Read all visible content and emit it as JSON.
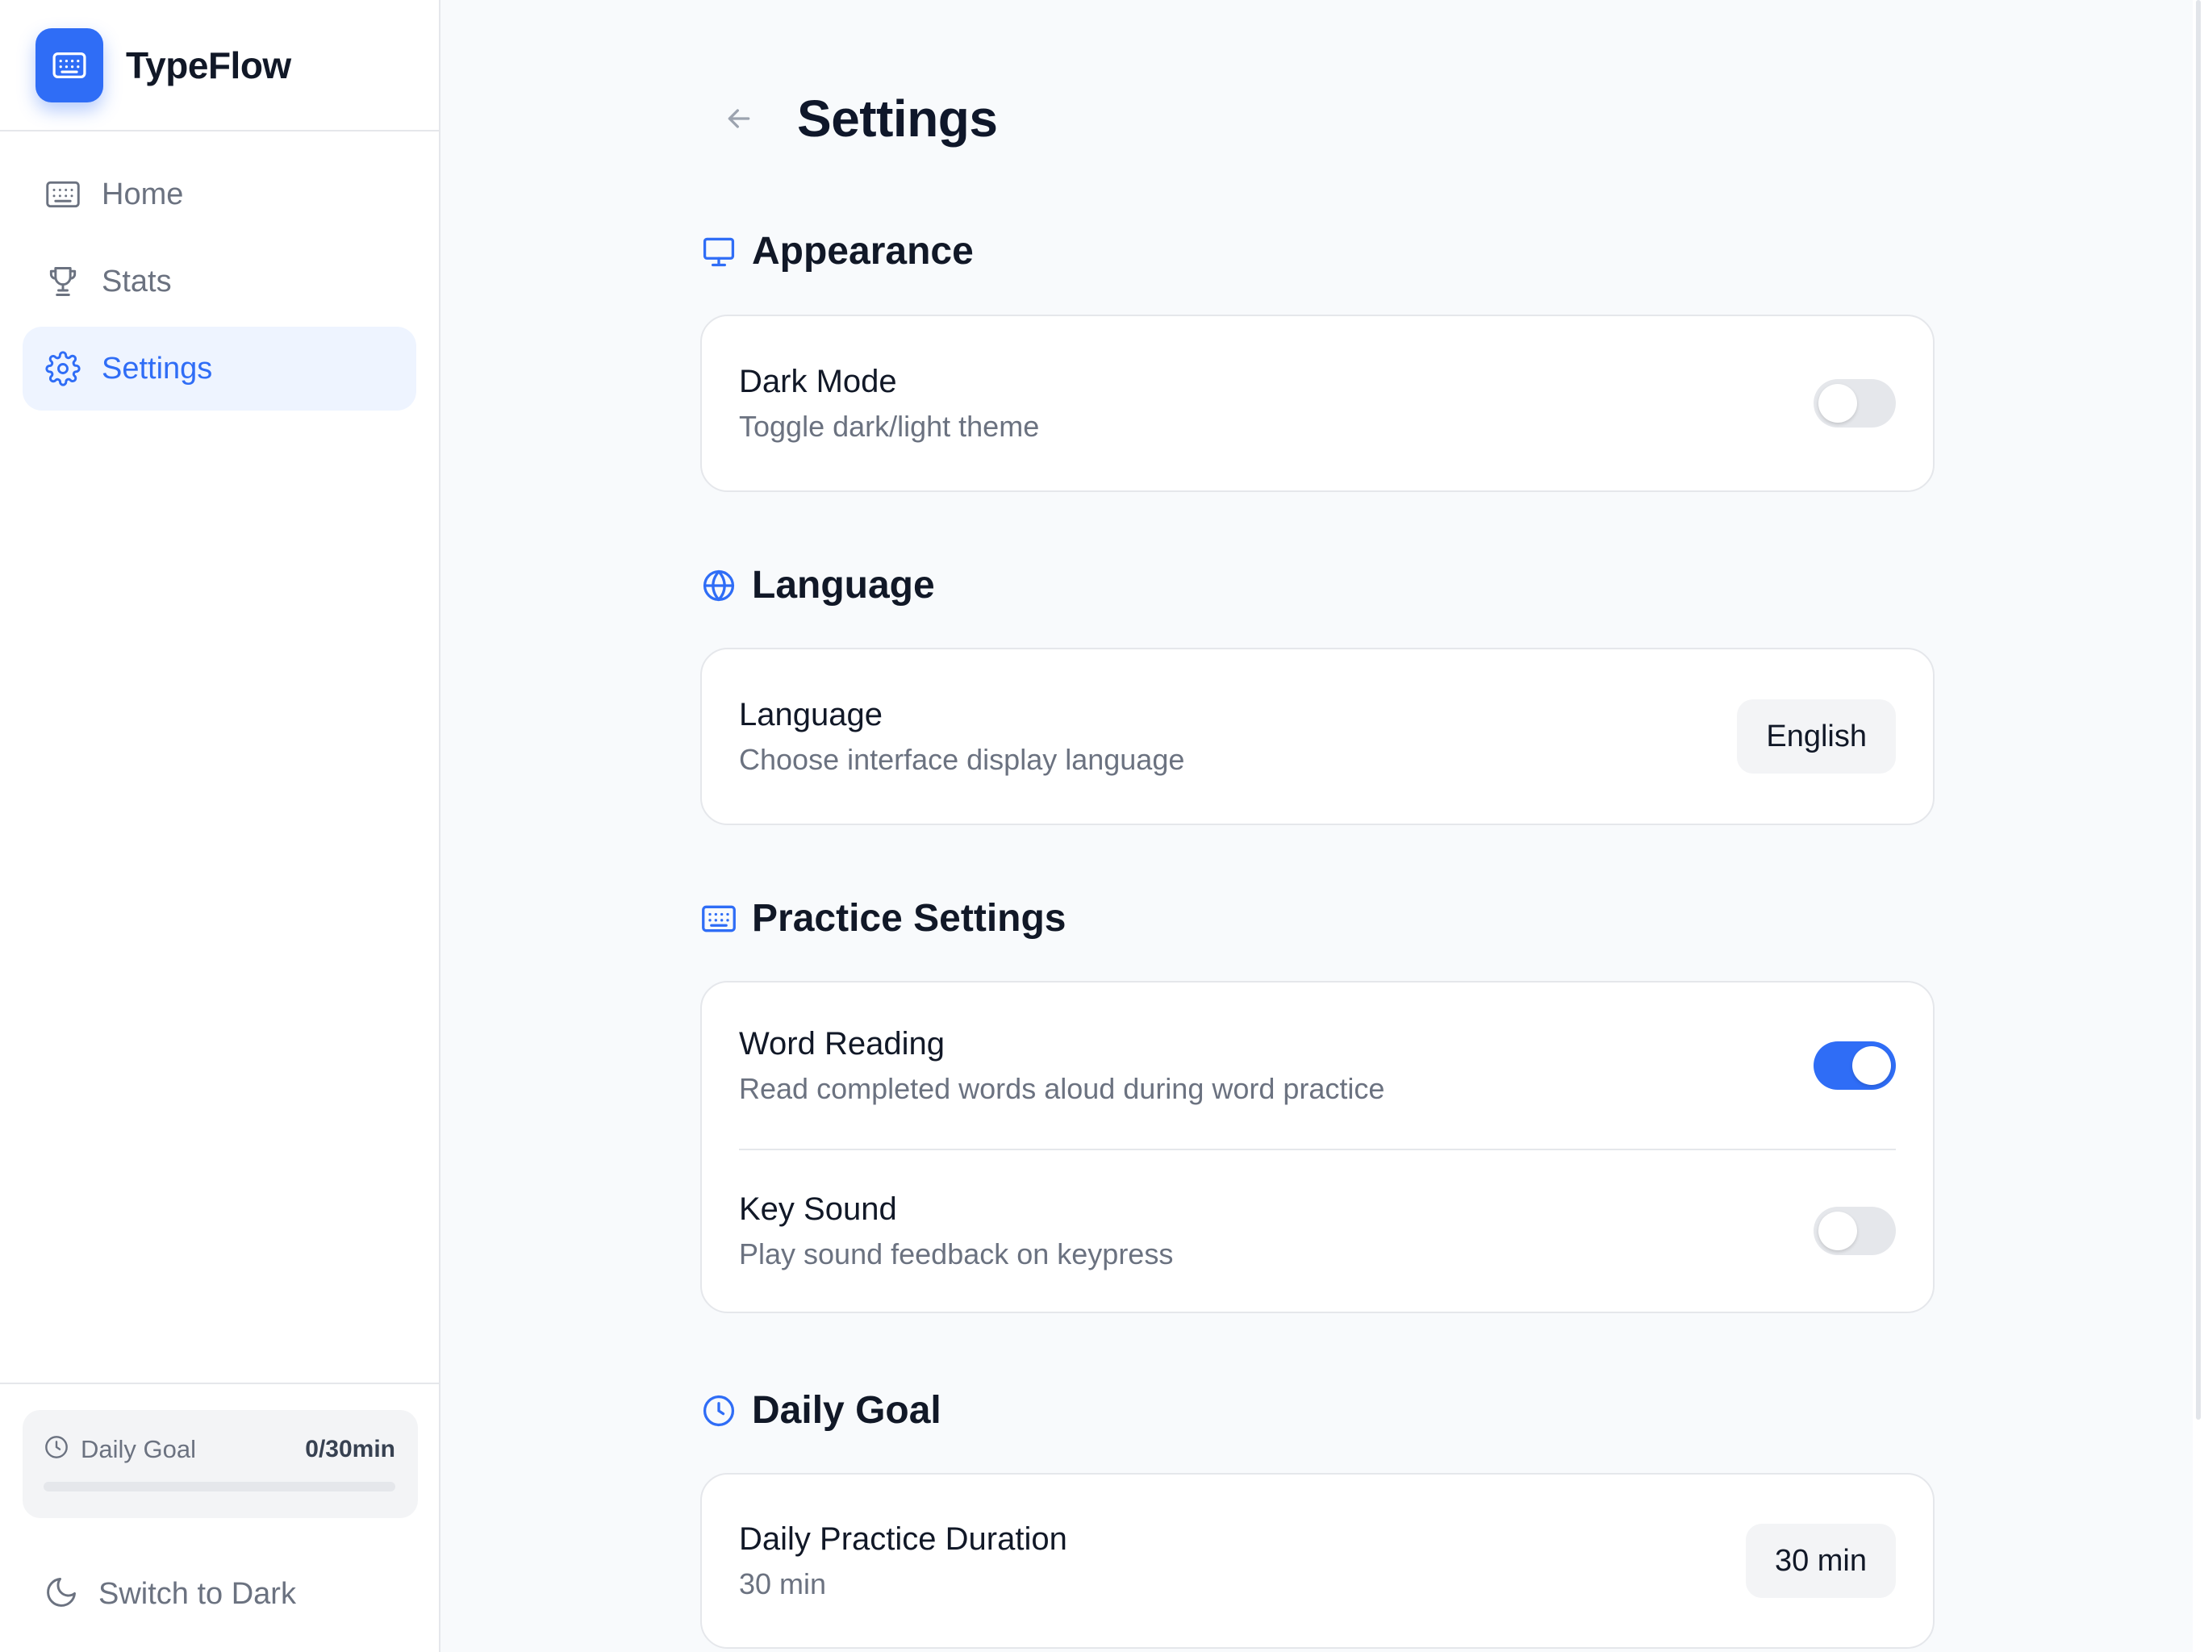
{
  "app": {
    "name": "TypeFlow"
  },
  "sidebar": {
    "items": [
      {
        "label": "Home",
        "icon": "keyboard-icon",
        "active": false
      },
      {
        "label": "Stats",
        "icon": "trophy-icon",
        "active": false
      },
      {
        "label": "Settings",
        "icon": "gear-icon",
        "active": true
      }
    ],
    "daily_goal": {
      "label": "Daily Goal",
      "value": "0/30min",
      "progress": 0
    },
    "switch_theme_label": "Switch to Dark"
  },
  "page": {
    "title": "Settings"
  },
  "sections": {
    "appearance": {
      "title": "Appearance",
      "dark_mode": {
        "title": "Dark Mode",
        "description": "Toggle dark/light theme",
        "enabled": false
      }
    },
    "language": {
      "title": "Language",
      "language_setting": {
        "title": "Language",
        "description": "Choose interface display language",
        "value": "English"
      }
    },
    "practice": {
      "title": "Practice Settings",
      "word_reading": {
        "title": "Word Reading",
        "description": "Read completed words aloud during word practice",
        "enabled": true
      },
      "key_sound": {
        "title": "Key Sound",
        "description": "Play sound feedback on keypress",
        "enabled": false
      }
    },
    "daily_goal": {
      "title": "Daily Goal",
      "duration": {
        "title": "Daily Practice Duration",
        "description": "30 min",
        "value": "30 min"
      }
    }
  },
  "colors": {
    "accent": "#2f6df6",
    "toggle_off": "#e5e7eb",
    "text_muted": "#6b7280"
  }
}
